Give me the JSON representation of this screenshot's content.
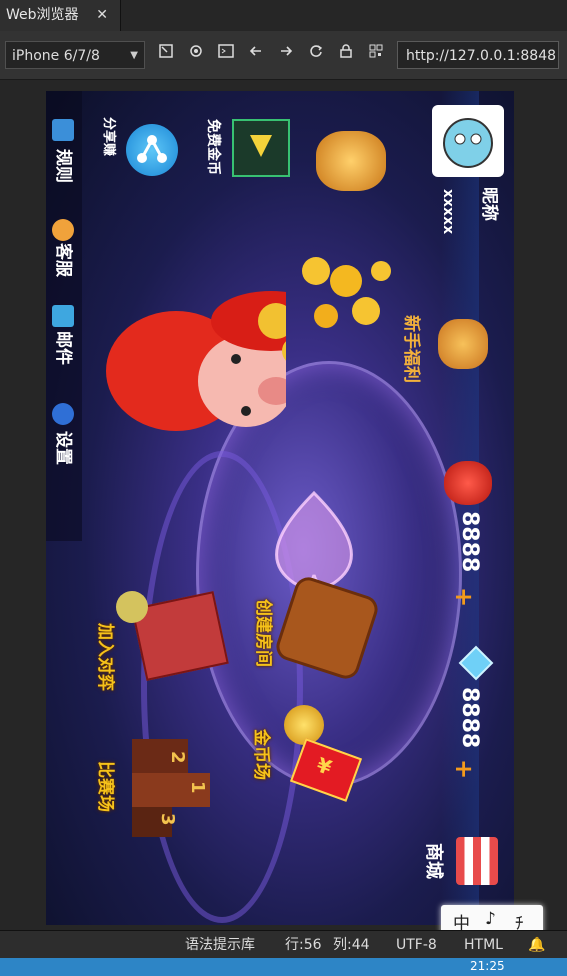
{
  "window": {
    "tab_title": "Web浏览器",
    "close_glyph": "✕"
  },
  "toolbar": {
    "device": "iPhone 6/7/8",
    "url": "http://127.0.0.1:8848",
    "icons": [
      "rotate-icon",
      "settings-icon",
      "console-icon",
      "back-icon",
      "forward-icon",
      "refresh-icon",
      "lock-icon",
      "qrcode-icon"
    ]
  },
  "game": {
    "nickname_label": "昵称",
    "nickname_value": "xxxxx",
    "free_coins": "免费金币",
    "share": "分享赚",
    "newbie_welfare": "新手福利",
    "coins": "8888",
    "diamonds": "8888",
    "plus": "+",
    "shop": "商城",
    "create_room": "创建房间",
    "join_game": "加入对弈",
    "coin_field": "金币场",
    "match_field": "比赛场",
    "menu": {
      "rules": "规则",
      "service": "客服",
      "mail": "邮件",
      "settings": "设置"
    },
    "podium": [
      "2",
      "1",
      "3"
    ],
    "red_packet_char": "¥"
  },
  "statusbar": {
    "hint": "语法提示库",
    "row": "行:56",
    "col": "列:44",
    "encoding": "UTF-8",
    "lang": "HTML"
  },
  "ime": {
    "a": "中",
    "b": "♪",
    "c": "ﾁ"
  },
  "taskbar": {
    "time": "21:25"
  }
}
